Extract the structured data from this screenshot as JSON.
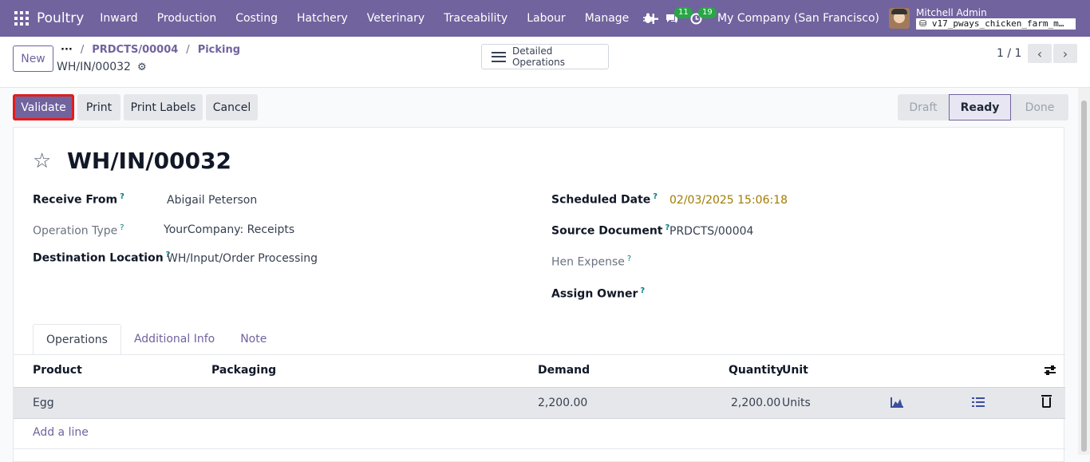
{
  "navbar": {
    "brand": "Poultry",
    "menu": [
      "Inward",
      "Production",
      "Costing",
      "Hatchery",
      "Veterinary",
      "Traceability",
      "Labour",
      "Manage"
    ],
    "plus": "+",
    "messages_count": "11",
    "activities_count": "19",
    "company": "My Company (San Francisco)",
    "user_name": "Mitchell Admin",
    "database": "v17_pways_chicken_farm_m…"
  },
  "control": {
    "new_label": "New",
    "breadcrumb_dots": "···",
    "breadcrumb": [
      "PRDCTS/00004",
      "Picking"
    ],
    "record": "WH/IN/00032",
    "detailed_ops": "Detailed Operations",
    "pager": "1 / 1"
  },
  "actions": {
    "validate": "Validate",
    "print": "Print",
    "print_labels": "Print Labels",
    "cancel": "Cancel"
  },
  "stages": [
    "Draft",
    "Ready",
    "Done"
  ],
  "form": {
    "title": "WH/IN/00032",
    "receive_from_label": "Receive From",
    "receive_from": "Abigail Peterson",
    "operation_type_label": "Operation Type",
    "operation_type": "YourCompany: Receipts",
    "destination_label": "Destination Location",
    "destination": "WH/Input/Order Processing",
    "scheduled_date_label": "Scheduled Date",
    "scheduled_date": "02/03/2025 15:06:18",
    "source_doc_label": "Source Document",
    "source_doc": "PRDCTS/00004",
    "hen_expense_label": "Hen Expense",
    "assign_owner_label": "Assign Owner",
    "help": "?"
  },
  "tabs": [
    "Operations",
    "Additional Info",
    "Note"
  ],
  "table": {
    "headers": {
      "product": "Product",
      "packaging": "Packaging",
      "demand": "Demand",
      "quantity": "Quantity",
      "unit": "Unit"
    },
    "rows": [
      {
        "product": "Egg",
        "packaging": "",
        "demand": "2,200.00",
        "quantity": "2,200.00",
        "unit": "Units"
      }
    ],
    "add_line": "Add a line"
  }
}
